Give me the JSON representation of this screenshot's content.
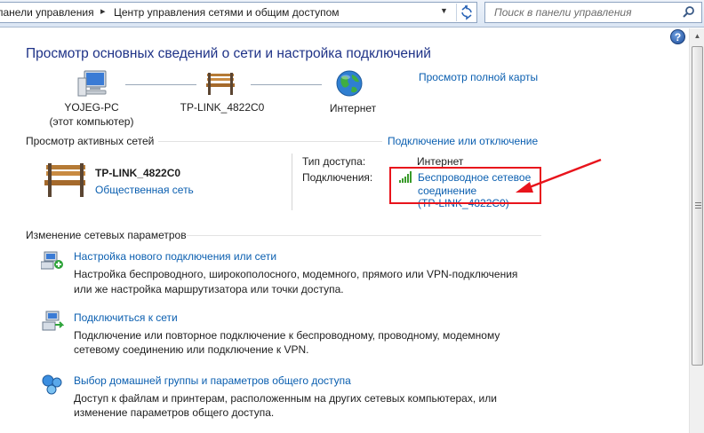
{
  "address_bar": {
    "crumbs": [
      "панели управления",
      "Центр управления сетями и общим доступом"
    ]
  },
  "search": {
    "placeholder": "Поиск в панели управления"
  },
  "help": {
    "label": "?"
  },
  "header": {
    "title": "Просмотр основных сведений о сети и настройка подключений",
    "full_map_link": "Просмотр полной карты"
  },
  "network_map": {
    "computer_name": "YOJEG-PC",
    "computer_sub": "(этот компьютер)",
    "router_name": "TP-LINK_4822C0",
    "internet_label": "Интернет"
  },
  "active_networks": {
    "section_label": "Просмотр активных сетей",
    "connect_link": "Подключение или отключение",
    "network_name": "TP-LINK_4822C0",
    "network_type": "Общественная сеть",
    "access_type_label": "Тип доступа:",
    "access_type_value": "Интернет",
    "connections_label": "Подключения:",
    "connection_link_line1": "Беспроводное сетевое",
    "connection_link_line2": "соединение",
    "connection_ssid": "(TP-LINK_4822C0)"
  },
  "change_settings": {
    "section_label": "Изменение сетевых параметров",
    "tasks": [
      {
        "link": "Настройка нового подключения или сети",
        "desc1": "Настройка беспроводного, широкополосного, модемного, прямого или VPN-подключения",
        "desc2": "или же настройка маршрутизатора или точки доступа."
      },
      {
        "link": "Подключиться к сети",
        "desc1": "Подключение или повторное подключение к беспроводному, проводному, модемному",
        "desc2": "сетевому соединению или подключение к VPN."
      },
      {
        "link": "Выбор домашней группы и параметров общего доступа",
        "desc1": "Доступ к файлам и принтерам, расположенным на других сетевых компьютерах, или",
        "desc2": "изменение параметров общего доступа."
      }
    ]
  },
  "colors": {
    "title": "#1e3287",
    "link": "#0b5fb0",
    "annotation": "#e8141c"
  }
}
